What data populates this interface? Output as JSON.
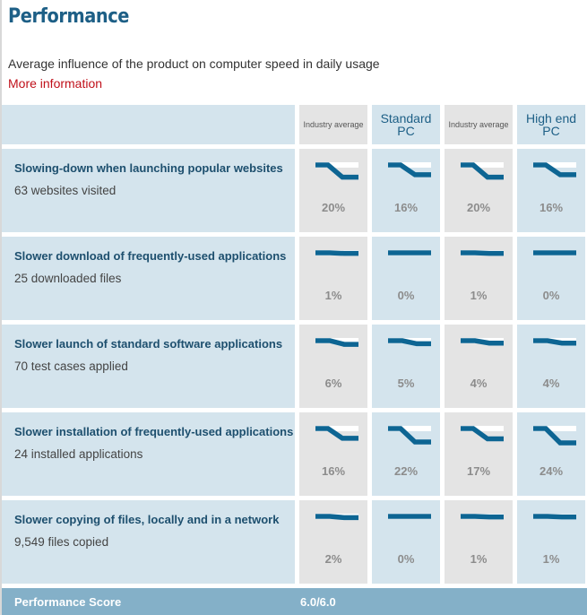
{
  "page": {
    "title": "Performance",
    "subtitle": "Average influence of the product on computer speed in daily usage",
    "more_link": "More information"
  },
  "colors": {
    "title": "#1d5f86",
    "link": "#c0101a",
    "line": "#0d6593",
    "blue_cell": "#d4e4ed",
    "grey_cell": "#e4e4e4",
    "score_bar": "#84b0c8"
  },
  "columns": [
    {
      "label": "Industry average",
      "style": "small",
      "shade": "grey"
    },
    {
      "label": "Standard PC",
      "style": "big",
      "shade": "blue"
    },
    {
      "label": "Industry average",
      "style": "small",
      "shade": "grey"
    },
    {
      "label": "High end PC",
      "style": "big",
      "shade": "blue"
    }
  ],
  "rows": [
    {
      "title": "Slowing-down when launching popular websites",
      "detail": "63 websites visited",
      "values": [
        "20%",
        "16%",
        "20%",
        "16%"
      ],
      "slowdown": [
        20,
        16,
        20,
        16
      ]
    },
    {
      "title": "Slower download of frequently-used applications",
      "detail": "25 downloaded files",
      "values": [
        "1%",
        "0%",
        "1%",
        "0%"
      ],
      "slowdown": [
        1,
        0,
        1,
        0
      ]
    },
    {
      "title": "Slower launch of standard software applications",
      "detail": "70 test cases applied",
      "values": [
        "6%",
        "5%",
        "4%",
        "4%"
      ],
      "slowdown": [
        6,
        5,
        4,
        4
      ]
    },
    {
      "title": "Slower installation of frequently-used applications",
      "detail": "24 installed applications",
      "values": [
        "16%",
        "22%",
        "17%",
        "24%"
      ],
      "slowdown": [
        16,
        22,
        17,
        24
      ]
    },
    {
      "title": "Slower copying of files, locally and in a network",
      "detail": "9,549 files copied",
      "values": [
        "2%",
        "0%",
        "1%",
        "1%"
      ],
      "slowdown": [
        2,
        0,
        1,
        1
      ]
    }
  ],
  "score": {
    "label": "Performance Score",
    "value": "6.0/6.0"
  }
}
